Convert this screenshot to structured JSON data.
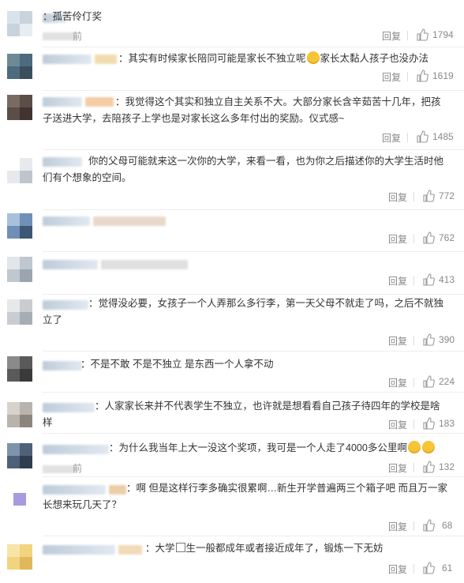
{
  "comments": [
    {
      "id": 1,
      "text": "孤苦伶仃奖",
      "time": "前",
      "reply": "回复",
      "likes": "1794"
    },
    {
      "id": 2,
      "text": "其实有时候家长陪同可能是家长不独立呢",
      "text2": "家长太黏人孩子也没办法",
      "reply": "回复",
      "likes": "1619"
    },
    {
      "id": 3,
      "text": "我觉得这个其实和独立自主关系不大。大部分家长含辛茹苦十几年，把孩子送进大学，去陪孩子上学也是对家长这么多年付出的奖励。仪式感~",
      "reply": "回复",
      "likes": "1485"
    },
    {
      "id": 4,
      "text": "你的父母可能就来这一次你的大学，来看一看，也为你之后描述你的大学生活时他们有个想象的空间。",
      "reply": "回复",
      "likes": "772"
    },
    {
      "id": 5,
      "text": "",
      "reply": "回复",
      "likes": "762"
    },
    {
      "id": 6,
      "text": "",
      "reply": "回复",
      "likes": "413"
    },
    {
      "id": 7,
      "text": "觉得没必要，女孩子一个人弄那么多行李，第一天父母不就走了吗，之后不就独立了",
      "reply": "回复",
      "likes": "390"
    },
    {
      "id": 8,
      "text": "不是不敢 不是不独立 是东西一个人拿不动",
      "reply": "回复",
      "likes": "224"
    },
    {
      "id": 9,
      "text": "人家家长来并不代表学生不独立，也许就是想看看自己孩子待四年的学校是啥样",
      "reply": "回复",
      "likes": "183"
    },
    {
      "id": 10,
      "text": "为什么我当年上大一没这个奖项，我可是一个人走了4000多公里啊",
      "time": "前",
      "reply": "回复",
      "likes": "132"
    },
    {
      "id": 11,
      "text": "啊 但是这样行李多确实很累啊…新生开学普遍两三个箱子吧 而且万一家长想来玩几天了？",
      "reply": "回复",
      "likes": "68"
    },
    {
      "id": 12,
      "text": "大学",
      "text2": "生一般都成年或者接近成年了，锻炼一下无妨",
      "reply": "回复",
      "likes": "61"
    }
  ],
  "colors": {
    "text": "#333333",
    "meta": "#888888",
    "divider": "#eeeeee"
  },
  "icons": {
    "like": "thumbs-up-icon"
  }
}
